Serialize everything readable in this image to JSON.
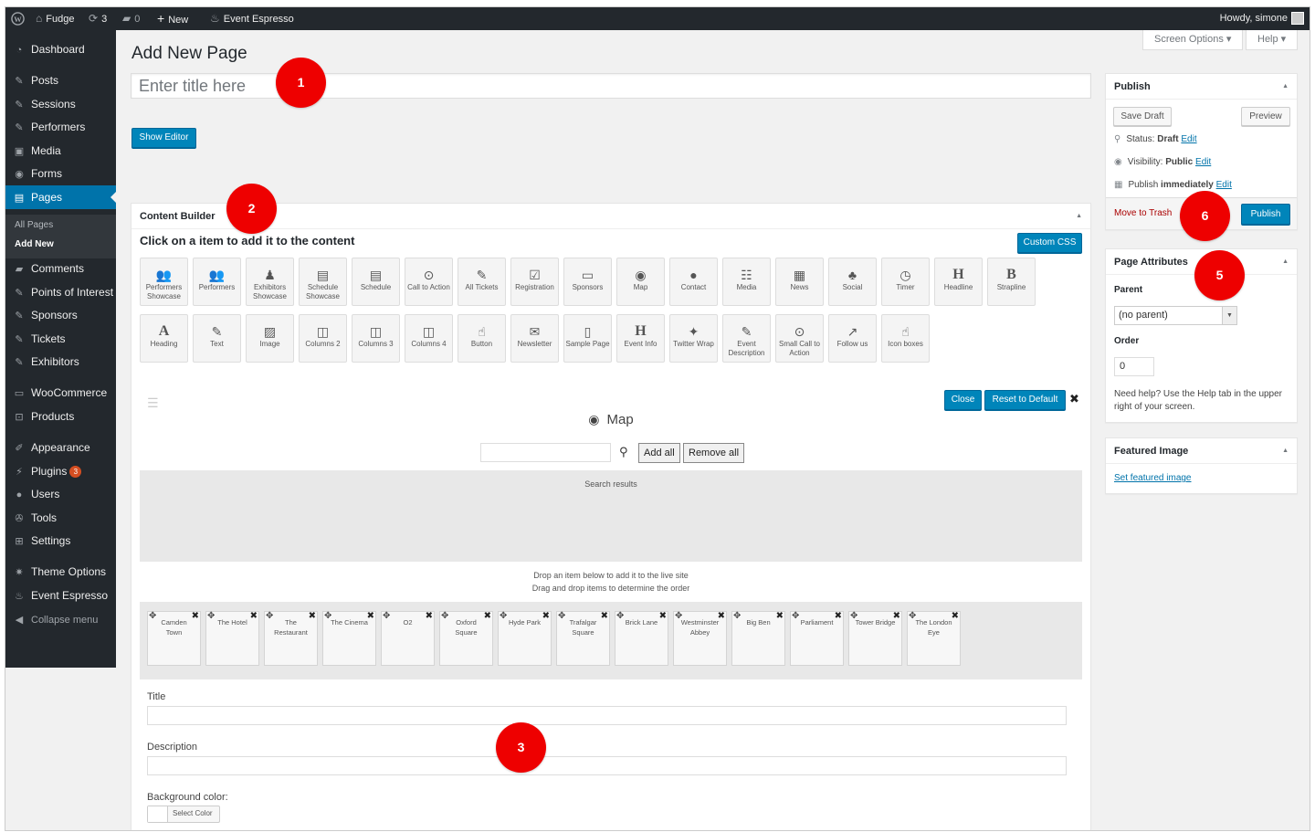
{
  "admin_bar": {
    "site_name": "Fudge",
    "updates_count": "3",
    "comments_count": "0",
    "new_label": "New",
    "plugin_label": "Event Espresso",
    "howdy": "Howdy, simone"
  },
  "sidebar": {
    "items": [
      {
        "label": "Dashboard",
        "icon": "dashboard-icon"
      },
      {
        "label": "Posts",
        "icon": "pin-icon"
      },
      {
        "label": "Sessions",
        "icon": "pin-icon"
      },
      {
        "label": "Performers",
        "icon": "pin-icon"
      },
      {
        "label": "Media",
        "icon": "media-icon"
      },
      {
        "label": "Forms",
        "icon": "forms-icon"
      },
      {
        "label": "Pages",
        "icon": "pages-icon"
      },
      {
        "label": "Comments",
        "icon": "comment-icon"
      },
      {
        "label": "Points of Interest",
        "icon": "pin-icon"
      },
      {
        "label": "Sponsors",
        "icon": "pin-icon"
      },
      {
        "label": "Tickets",
        "icon": "pin-icon"
      },
      {
        "label": "Exhibitors",
        "icon": "pin-icon"
      },
      {
        "label": "WooCommerce",
        "icon": "woocommerce-icon"
      },
      {
        "label": "Products",
        "icon": "cart-icon"
      },
      {
        "label": "Appearance",
        "icon": "brush-icon"
      },
      {
        "label": "Plugins",
        "icon": "plugin-icon",
        "badge": "3"
      },
      {
        "label": "Users",
        "icon": "user-icon"
      },
      {
        "label": "Tools",
        "icon": "wrench-icon"
      },
      {
        "label": "Settings",
        "icon": "settings-icon"
      },
      {
        "label": "Theme Options",
        "icon": "gear-icon"
      },
      {
        "label": "Event Espresso",
        "icon": "ticket-icon"
      }
    ],
    "submenu": {
      "all_pages": "All Pages",
      "add_new": "Add New"
    },
    "collapse": "Collapse menu"
  },
  "screen_options": "Screen Options",
  "help": "Help",
  "page_title": "Add New Page",
  "title_placeholder": "Enter title here",
  "show_editor": "Show Editor",
  "content_builder": {
    "heading": "Content Builder",
    "instruction": "Click on a item to add it to the content",
    "custom_css": "Custom CSS",
    "items": [
      {
        "label": "Performers Showcase",
        "icon": "users-icon"
      },
      {
        "label": "Performers",
        "icon": "users-icon"
      },
      {
        "label": "Exhibitors Showcase",
        "icon": "person-icon"
      },
      {
        "label": "Schedule Showcase",
        "icon": "schedule-icon"
      },
      {
        "label": "Schedule",
        "icon": "schedule-icon"
      },
      {
        "label": "Call to Action",
        "icon": "gamepad-icon"
      },
      {
        "label": "All Tickets",
        "icon": "tickets-icon"
      },
      {
        "label": "Registration",
        "icon": "checkbox-icon"
      },
      {
        "label": "Sponsors",
        "icon": "money-icon"
      },
      {
        "label": "Map",
        "icon": "target-icon"
      },
      {
        "label": "Contact",
        "icon": "chat-icon"
      },
      {
        "label": "Media",
        "icon": "grid-list-icon"
      },
      {
        "label": "News",
        "icon": "newspaper-icon"
      },
      {
        "label": "Social",
        "icon": "user-plus-icon"
      },
      {
        "label": "Timer",
        "icon": "clock-icon"
      },
      {
        "label": "Headline",
        "icon": "h-icon"
      },
      {
        "label": "Strapline",
        "icon": "bold-icon"
      },
      {
        "label": "Heading",
        "icon": "a-icon"
      },
      {
        "label": "Text",
        "icon": "pencil-icon"
      },
      {
        "label": "Image",
        "icon": "image-icon"
      },
      {
        "label": "Columns 2",
        "icon": "columns-icon"
      },
      {
        "label": "Columns 3",
        "icon": "columns-icon"
      },
      {
        "label": "Columns 4",
        "icon": "columns-icon"
      },
      {
        "label": "Button",
        "icon": "hand-pointer-icon"
      },
      {
        "label": "Newsletter",
        "icon": "envelope-icon"
      },
      {
        "label": "Sample Page",
        "icon": "file-icon"
      },
      {
        "label": "Event Info",
        "icon": "h-icon"
      },
      {
        "label": "Twitter Wrap",
        "icon": "twitter-icon"
      },
      {
        "label": "Event Description",
        "icon": "pencil-icon"
      },
      {
        "label": "Small Call to Action",
        "icon": "gamepad-icon"
      },
      {
        "label": "Follow us",
        "icon": "share-icon"
      },
      {
        "label": "Icon boxes",
        "icon": "hand-pointer-icon"
      }
    ],
    "map_panel": {
      "title": "Map",
      "close": "Close",
      "reset": "Reset to Default",
      "add_all": "Add all",
      "remove_all": "Remove all",
      "search_results": "Search results",
      "drop_line1": "Drop an item below to add it to the live site",
      "drop_line2": "Drag and drop items to determine the order",
      "places": [
        "Camden Town",
        "The Hotel",
        "The Restaurant",
        "The Cinema",
        "O2",
        "Oxford Square",
        "Hyde Park",
        "Trafalgar Square",
        "Brick Lane",
        "Westminster Abbey",
        "Big Ben",
        "Parliament",
        "Tower Bridge",
        "The London Eye"
      ],
      "title_label": "Title",
      "description_label": "Description",
      "bg_label": "Background color:",
      "select_color": "Select Color"
    }
  },
  "publish": {
    "heading": "Publish",
    "save_draft": "Save Draft",
    "preview": "Preview",
    "status_label": "Status:",
    "status_value": "Draft",
    "visibility_label": "Visibility:",
    "visibility_value": "Public",
    "publish_label": "Publish",
    "publish_value": "immediately",
    "edit": "Edit",
    "trash": "Move to Trash",
    "publish_button": "Publish"
  },
  "page_attributes": {
    "heading": "Page Attributes",
    "parent_label": "Parent",
    "parent_value": "(no parent)",
    "order_label": "Order",
    "order_value": "0",
    "help": "Need help? Use the Help tab in the upper right of your screen."
  },
  "featured_image": {
    "heading": "Featured Image",
    "link": "Set featured image"
  },
  "markers": [
    "1",
    "2",
    "3",
    "5",
    "6"
  ]
}
